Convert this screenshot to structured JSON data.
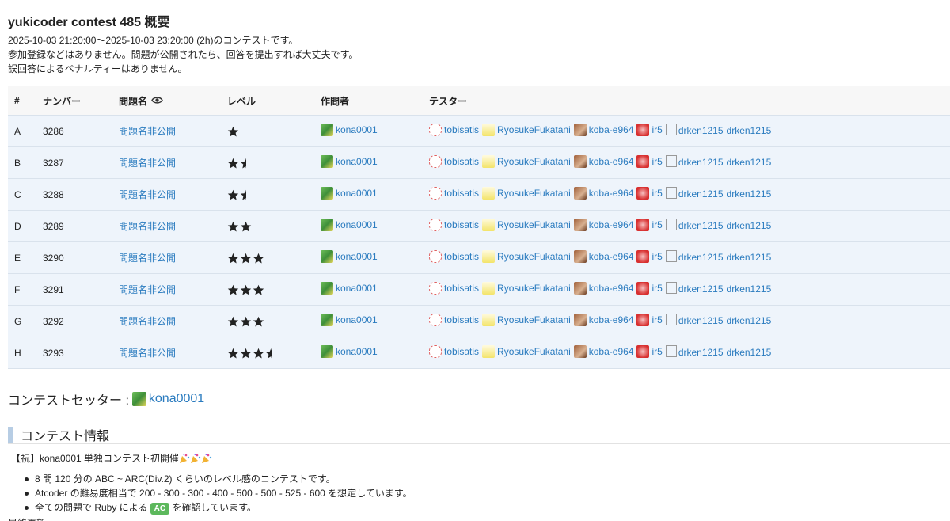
{
  "title": "yukicoder contest 485 概要",
  "intro": [
    "2025-10-03 21:20:00〜2025-10-03 23:20:00 (2h)のコンテストです。",
    "参加登録などはありません。問題が公開されたら、回答を提出すれば大丈夫です。",
    "誤回答によるペナルティーはありません。"
  ],
  "table": {
    "headers": [
      "#",
      "ナンバー",
      "問題名",
      "レベル",
      "作問者",
      "テスター"
    ],
    "rows": [
      {
        "id": "A",
        "number": "3286",
        "name": "問題名非公開",
        "level": 1,
        "author": "kona0001"
      },
      {
        "id": "B",
        "number": "3287",
        "name": "問題名非公開",
        "level": 1.5,
        "author": "kona0001"
      },
      {
        "id": "C",
        "number": "3288",
        "name": "問題名非公開",
        "level": 1.5,
        "author": "kona0001"
      },
      {
        "id": "D",
        "number": "3289",
        "name": "問題名非公開",
        "level": 2,
        "author": "kona0001"
      },
      {
        "id": "E",
        "number": "3290",
        "name": "問題名非公開",
        "level": 3,
        "author": "kona0001"
      },
      {
        "id": "F",
        "number": "3291",
        "name": "問題名非公開",
        "level": 3,
        "author": "kona0001"
      },
      {
        "id": "G",
        "number": "3292",
        "name": "問題名非公開",
        "level": 3,
        "author": "kona0001"
      },
      {
        "id": "H",
        "number": "3293",
        "name": "問題名非公開",
        "level": 3.5,
        "author": "kona0001"
      }
    ],
    "testers": [
      {
        "name": "tobisatis",
        "avatar": "tobi"
      },
      {
        "name": "RyosukeFukatani",
        "avatar": "ryo"
      },
      {
        "name": "koba-e964",
        "avatar": "koba"
      },
      {
        "name": "ir5",
        "avatar": "ir5"
      },
      {
        "name": "drken1215",
        "avatar": "broken",
        "alt": "drken1215"
      }
    ]
  },
  "setter": {
    "label": "コンテストセッター :",
    "name": "kona0001"
  },
  "info": {
    "heading": "コンテスト情報",
    "celebrate": "【祝】kona0001 単独コンテスト初開催",
    "bullets": [
      "8 問 120 分の ABC ~ ARC(Div.2) くらいのレベル感のコンテストです。",
      "Atcoder の難易度相当で 200 - 300 - 300 - 400 - 500 - 500 - 525 - 600 を想定しています。",
      {
        "before": "全ての問題で Ruby による ",
        "badge": "AC",
        "after": " を確認しています。"
      }
    ],
    "cut_text": "最終更新"
  },
  "colors": {
    "link": "#2a7bbf",
    "row_bg": "#eef4fb",
    "header_bg": "#f7f7f7",
    "badge": "#5cb85c",
    "section_bar": "#b7cde4"
  }
}
